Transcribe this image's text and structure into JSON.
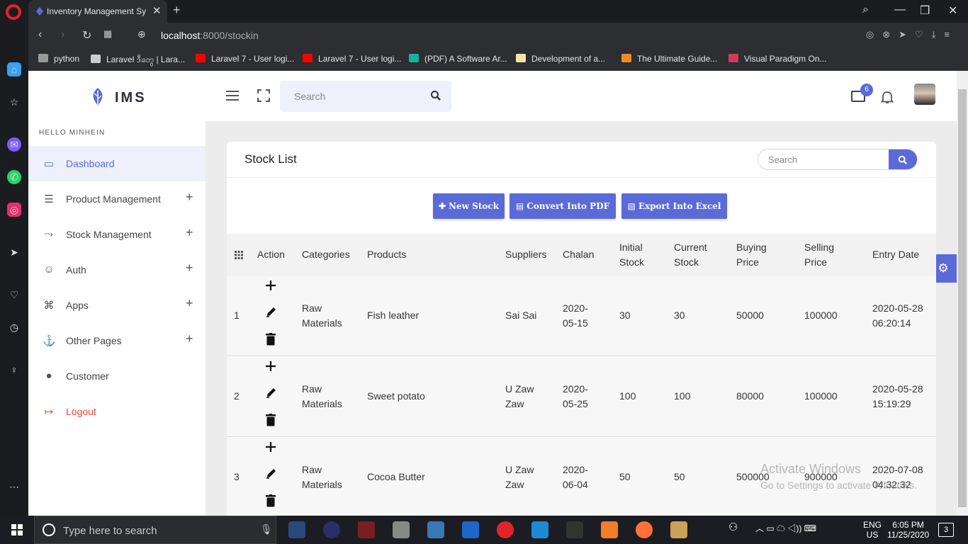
{
  "browser": {
    "tab_title": "Inventory Management Sys",
    "url_host": "localhost",
    "url_rest": ":8000/stockin",
    "bookmarks": [
      {
        "label": "python",
        "color": "#999999"
      },
      {
        "label": "Laravel ဒီတွေ | Lara...",
        "color": "#cccccc"
      },
      {
        "label": "Laravel 7 - User logi...",
        "color": "#ff0000"
      },
      {
        "label": "Laravel 7 - User logi...",
        "color": "#ff0000"
      },
      {
        "label": "(PDF) A Software Ar...",
        "color": "#15b39e"
      },
      {
        "label": "Development of a...",
        "color": "#f2e6a8"
      },
      {
        "label": "The Ultimate Guide...",
        "color": "#f08a24"
      },
      {
        "label": "Visual Paradigm On...",
        "color": "#d23a5a"
      }
    ]
  },
  "app": {
    "brand": "IMS",
    "greeting": "HELLO MINHEIN",
    "search_placeholder": "Search",
    "mail_count": "6",
    "accent": "#5a6bd8"
  },
  "sidebar": {
    "items": [
      {
        "label": "Dashboard",
        "icon": "monitor-icon",
        "glyph": "▭",
        "expandable": false
      },
      {
        "label": "Product Management",
        "icon": "gift-icon",
        "glyph": "☰",
        "expandable": true
      },
      {
        "label": "Stock Management",
        "icon": "stock-icon",
        "glyph": "⤳",
        "expandable": true
      },
      {
        "label": "Auth",
        "icon": "user-icon",
        "glyph": "☺",
        "expandable": true
      },
      {
        "label": "Apps",
        "icon": "command-icon",
        "glyph": "⌘",
        "expandable": true
      },
      {
        "label": "Other Pages",
        "icon": "anchor-icon",
        "glyph": "⚓",
        "expandable": true
      },
      {
        "label": "Customer",
        "icon": "user-circle-icon",
        "glyph": "●",
        "expandable": false
      },
      {
        "label": "Logout",
        "icon": "sign-out-icon",
        "glyph": "↦",
        "expandable": false
      }
    ]
  },
  "card": {
    "title": "Stock List",
    "search_placeholder": "Search",
    "buttons": {
      "new_stock": "New Stock",
      "pdf": "Convert Into PDF",
      "excel": "Export Into Excel"
    }
  },
  "table": {
    "headers": {
      "action": "Action",
      "categories": "Categories",
      "products": "Products",
      "suppliers": "Suppliers",
      "chalan": "Chalan",
      "initial_1": "Initial",
      "initial_2": "Stock",
      "current_1": "Current",
      "current_2": "Stock",
      "buying_1": "Buying",
      "buying_2": "Price",
      "selling_1": "Selling",
      "selling_2": "Price",
      "entry_date": "Entry Date"
    },
    "rows": [
      {
        "no": "1",
        "cat_1": "Raw",
        "cat_2": "Materials",
        "product": "Fish leather",
        "sup_1": "Sai Sai",
        "sup_2": "",
        "chalan_1": "2020-",
        "chalan_2": "05-15",
        "initial": "30",
        "current": "30",
        "buying": "50000",
        "selling": "100000",
        "date_1": "2020-05-28",
        "date_2": "06:20:14"
      },
      {
        "no": "2",
        "cat_1": "Raw",
        "cat_2": "Materials",
        "product": "Sweet potato",
        "sup_1": "U Zaw",
        "sup_2": "Zaw",
        "chalan_1": "2020-",
        "chalan_2": "05-25",
        "initial": "100",
        "current": "100",
        "buying": "80000",
        "selling": "100000",
        "date_1": "2020-05-28",
        "date_2": "15:19:29"
      },
      {
        "no": "3",
        "cat_1": "Raw",
        "cat_2": "Materials",
        "product": "Cocoa Butter",
        "sup_1": "U Zaw",
        "sup_2": "Zaw",
        "chalan_1": "2020-",
        "chalan_2": "06-04",
        "initial": "50",
        "current": "50",
        "buying": "500000",
        "selling": "900000",
        "date_1": "2020-07-08",
        "date_2": "04:32:32"
      }
    ]
  },
  "watermark": {
    "line1": "Activate Windows",
    "line2": "Go to Settings to activate Windows."
  },
  "taskbar": {
    "search_placeholder": "Type here to search",
    "lang_1": "ENG",
    "lang_2": "US",
    "time": "6:05 PM",
    "date": "11/25/2020",
    "notifications": "3"
  }
}
